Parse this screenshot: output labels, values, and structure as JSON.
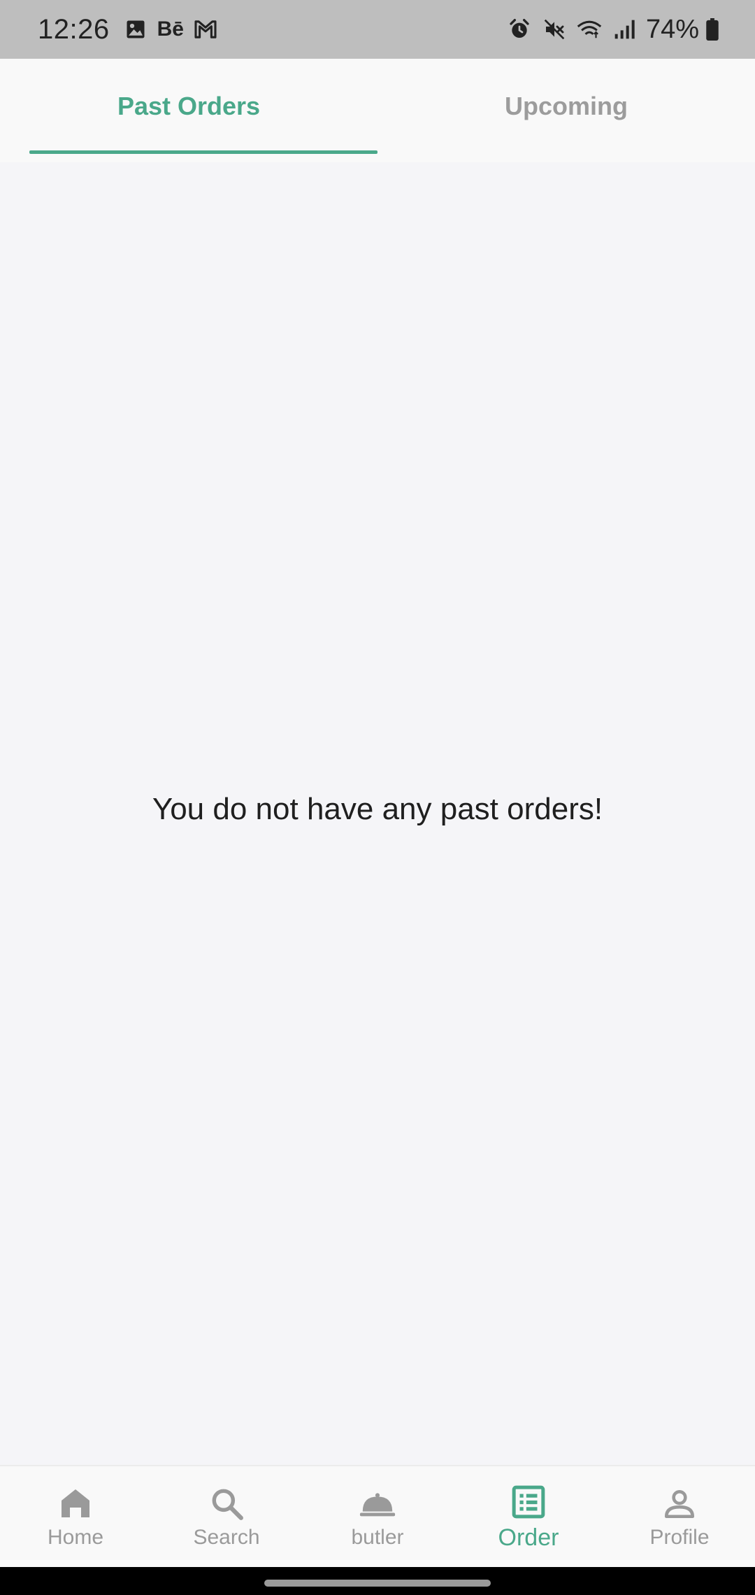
{
  "status_bar": {
    "time": "12:26",
    "battery_percent": "74%",
    "behance_label": "Bē",
    "notification_icons": [
      "image-icon",
      "behance-icon",
      "gmail-icon"
    ],
    "system_icons": [
      "alarm-icon",
      "mute-icon",
      "wifi-icon",
      "signal-icon",
      "battery-icon"
    ]
  },
  "tabs": {
    "past_orders": "Past Orders",
    "upcoming": "Upcoming",
    "active": "past_orders"
  },
  "main": {
    "empty_message": "You do not have any past orders!"
  },
  "bottom_nav": {
    "items": [
      {
        "label": "Home",
        "icon": "home-icon"
      },
      {
        "label": "Search",
        "icon": "search-icon"
      },
      {
        "label": "butler",
        "icon": "cloche-icon"
      },
      {
        "label": "Order",
        "icon": "order-list-icon"
      },
      {
        "label": "Profile",
        "icon": "profile-icon"
      }
    ],
    "active_index": 3
  },
  "colors": {
    "accent": "#4aa88a",
    "inactive": "#9a9a9a",
    "status_bar": "#bebebe",
    "background": "#f5f5f8"
  }
}
